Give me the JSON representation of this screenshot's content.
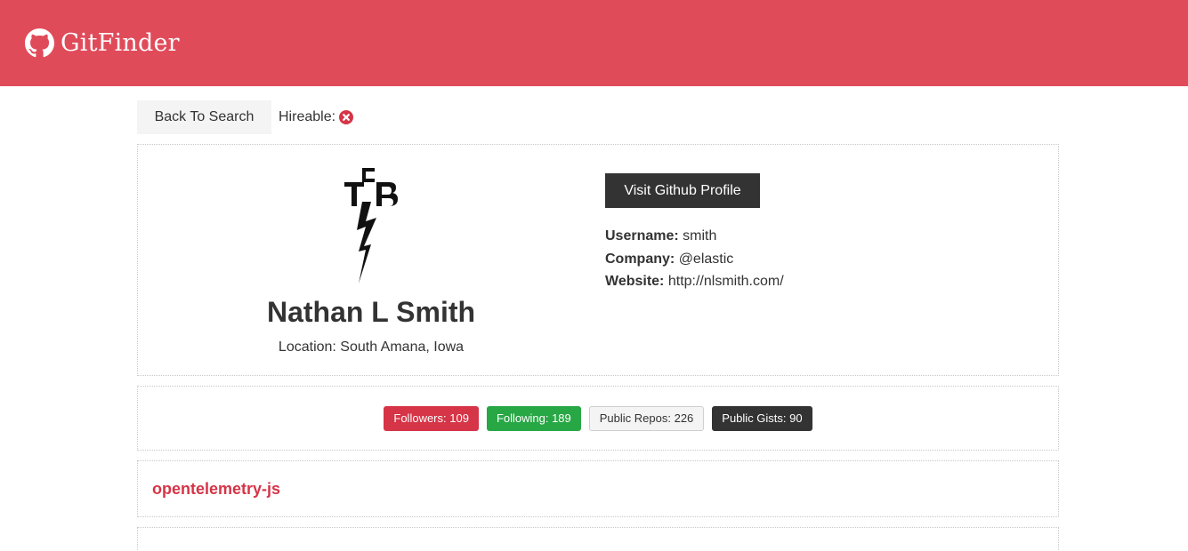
{
  "navbar": {
    "brand": "GitFinder",
    "icon": "github-icon"
  },
  "toolbar": {
    "back_label": "Back To Search",
    "hireable_label": "Hireable:",
    "hireable_icon": "times-circle-icon"
  },
  "profile": {
    "name": "Nathan L Smith",
    "location": "Location: South Amana, Iowa",
    "visit_label": "Visit Github Profile",
    "username_label": "Username:",
    "username": "smith",
    "company_label": "Company:",
    "company": "@elastic",
    "website_label": "Website:",
    "website": "http://nlsmith.com/"
  },
  "stats": {
    "followers": "Followers: 109",
    "following": "Following: 189",
    "public_repos": "Public Repos: 226",
    "public_gists": "Public Gists: 90"
  },
  "repos": [
    {
      "name": "opentelemetry-js"
    }
  ],
  "colors": {
    "brand": "#e04b5a",
    "danger": "#d63447",
    "success": "#28a745",
    "dark": "#333333",
    "light": "#f4f4f4"
  }
}
